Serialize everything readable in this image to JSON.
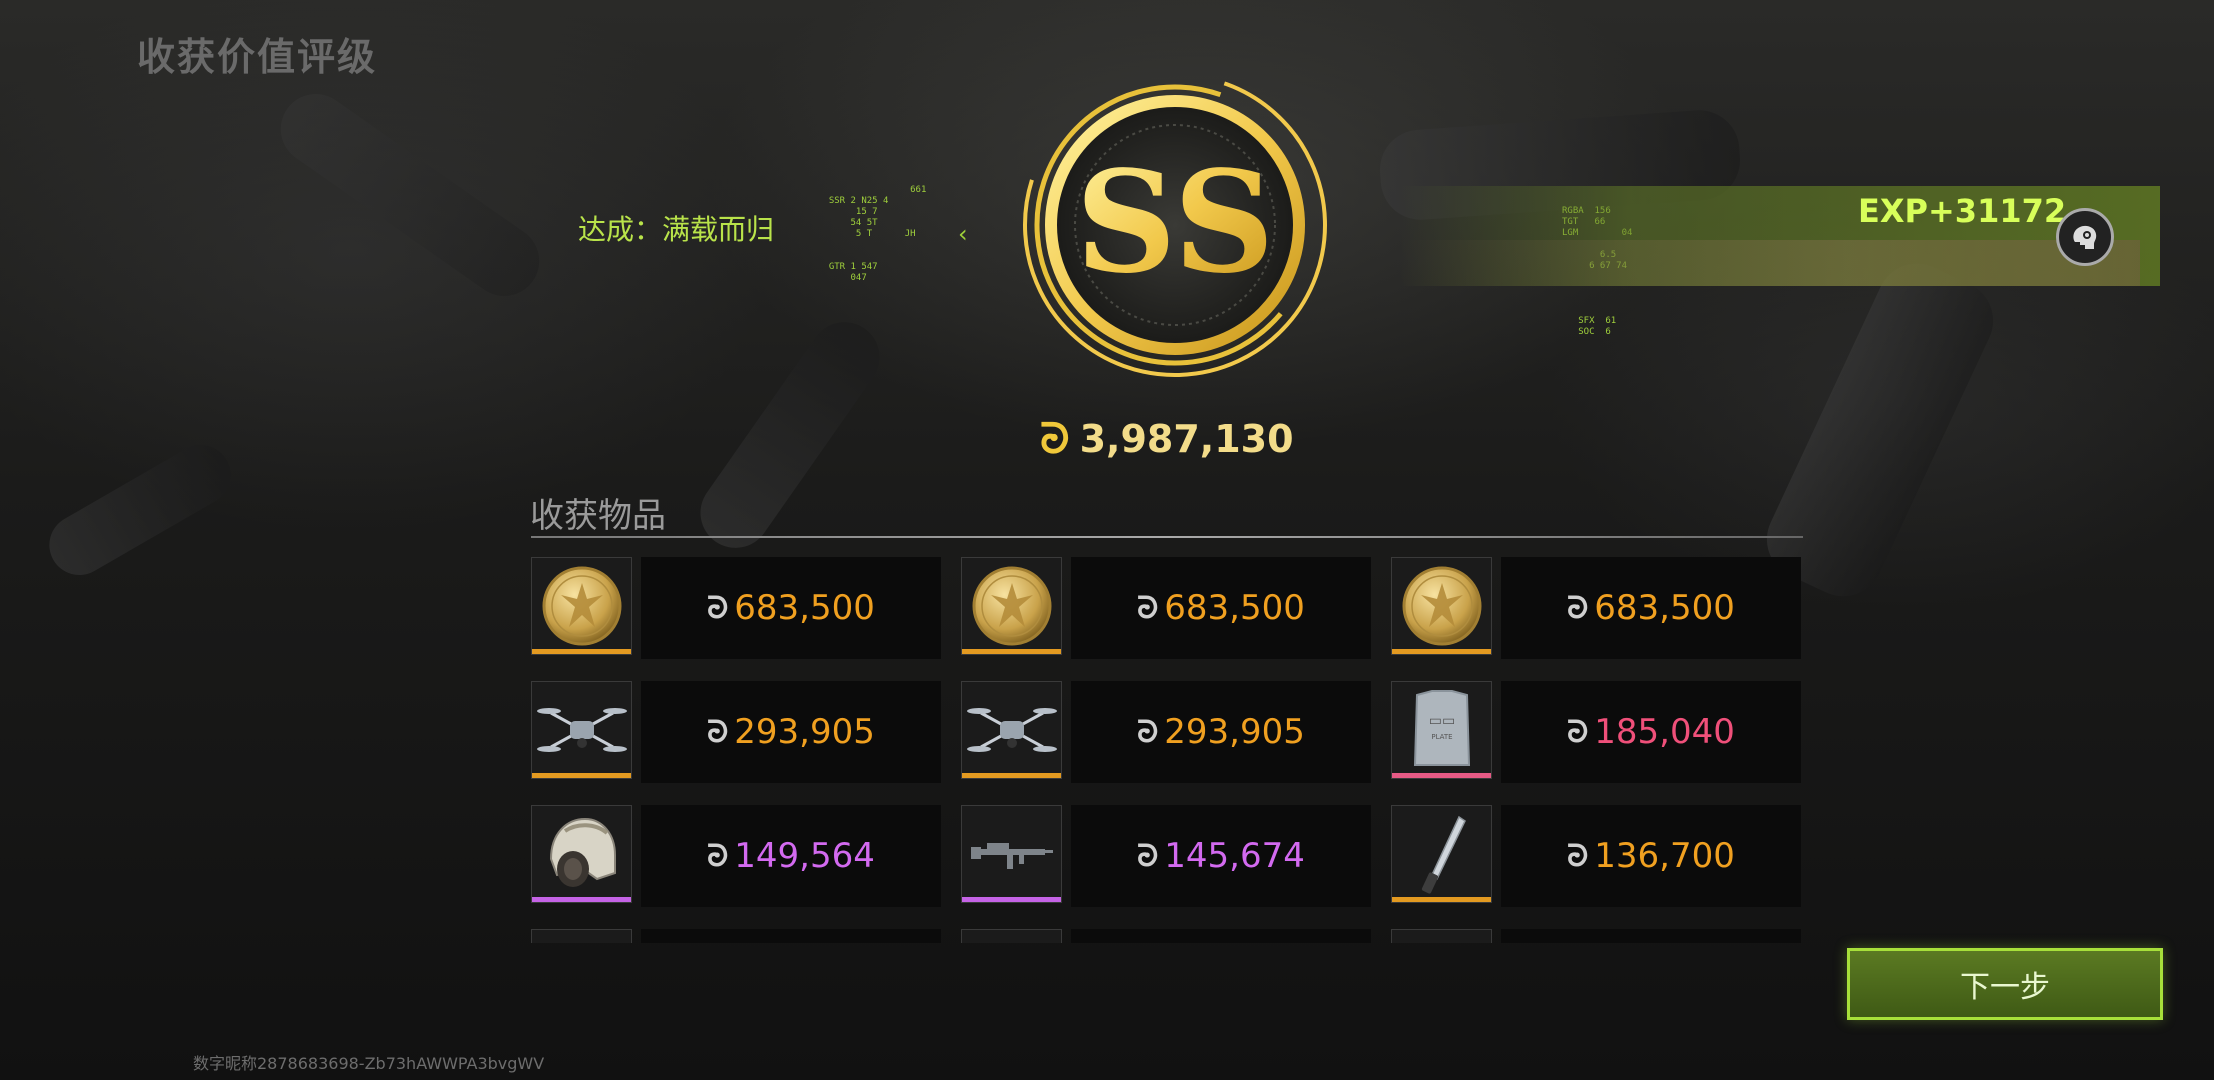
{
  "title": "收获价值评级",
  "achievement": "达成：满载而归",
  "rank": {
    "grade": "SS",
    "color": "#f2c94c"
  },
  "exp": "EXP+31172",
  "total_value": "3,987,130",
  "currency_symbol": "ᘒ",
  "section_title": "收获物品",
  "items": [
    {
      "icon": "gold-coin-icon",
      "value": "683,500",
      "color": "#f0a020",
      "bar": "#e39a21"
    },
    {
      "icon": "gold-coin-icon",
      "value": "683,500",
      "color": "#f0a020",
      "bar": "#e39a21"
    },
    {
      "icon": "gold-coin-icon",
      "value": "683,500",
      "color": "#f0a020",
      "bar": "#e39a21"
    },
    {
      "icon": "drone-icon",
      "value": "293,905",
      "color": "#f0a020",
      "bar": "#e39a21"
    },
    {
      "icon": "drone-icon",
      "value": "293,905",
      "color": "#f0a020",
      "bar": "#e39a21"
    },
    {
      "icon": "armor-plate-icon",
      "value": "185,040",
      "color": "#f0507a",
      "bar": "#e65a85"
    },
    {
      "icon": "helmet-icon",
      "value": "149,564",
      "color": "#d36af0",
      "bar": "#c563e6"
    },
    {
      "icon": "rifle-icon",
      "value": "145,674",
      "color": "#d36af0",
      "bar": "#c563e6"
    },
    {
      "icon": "knife-icon",
      "value": "136,700",
      "color": "#f0a020",
      "bar": "#e39a21"
    }
  ],
  "next_button": "下一步",
  "user_id": "数字昵称2878683698-Zb73hAWWPA3bvgWV"
}
